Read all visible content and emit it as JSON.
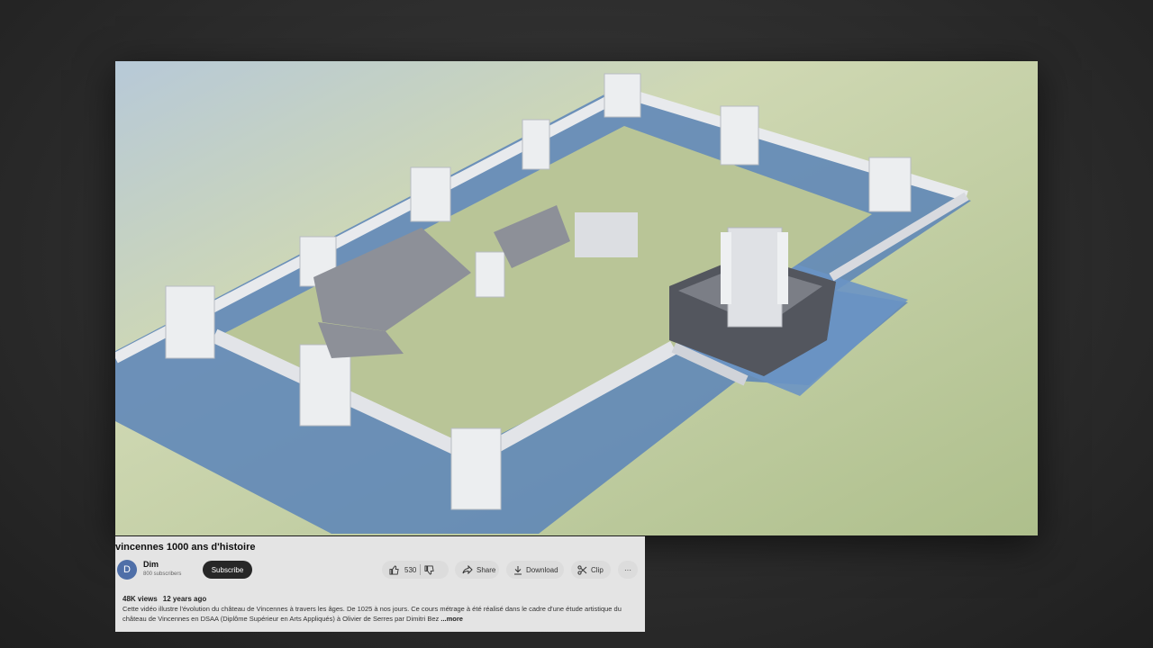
{
  "video": {
    "title": "vincennes 1000 ans d'histoire",
    "scene": "3D model of the Château de Vincennes fortress with corner towers, moat and donjon"
  },
  "channel": {
    "avatar_letter": "D",
    "name": "Dim",
    "subscribers": "800 subscribers",
    "subscribe_label": "Subscribe"
  },
  "actions": {
    "like_count": "530",
    "share_label": "Share",
    "download_label": "Download",
    "clip_label": "Clip",
    "more_label": "···"
  },
  "description": {
    "views": "48K views",
    "age": "12 years ago",
    "text": "Cette vidéo illustre l'évolution du château de Vincennes à travers les âges. De 1025 à nos jours. Ce cours métrage à été réalisé dans le cadre d'une étude artistique du château de Vincennes en DSAA (Diplôme Supérieur en Arts Appliqués) à Olivier de Serres par Dimitri Bez",
    "more_label": "...more"
  },
  "colors": {
    "subscribe_bg": "#272727",
    "panel_bg": "#ececec",
    "avatar_bg": "#4f6fa8"
  }
}
